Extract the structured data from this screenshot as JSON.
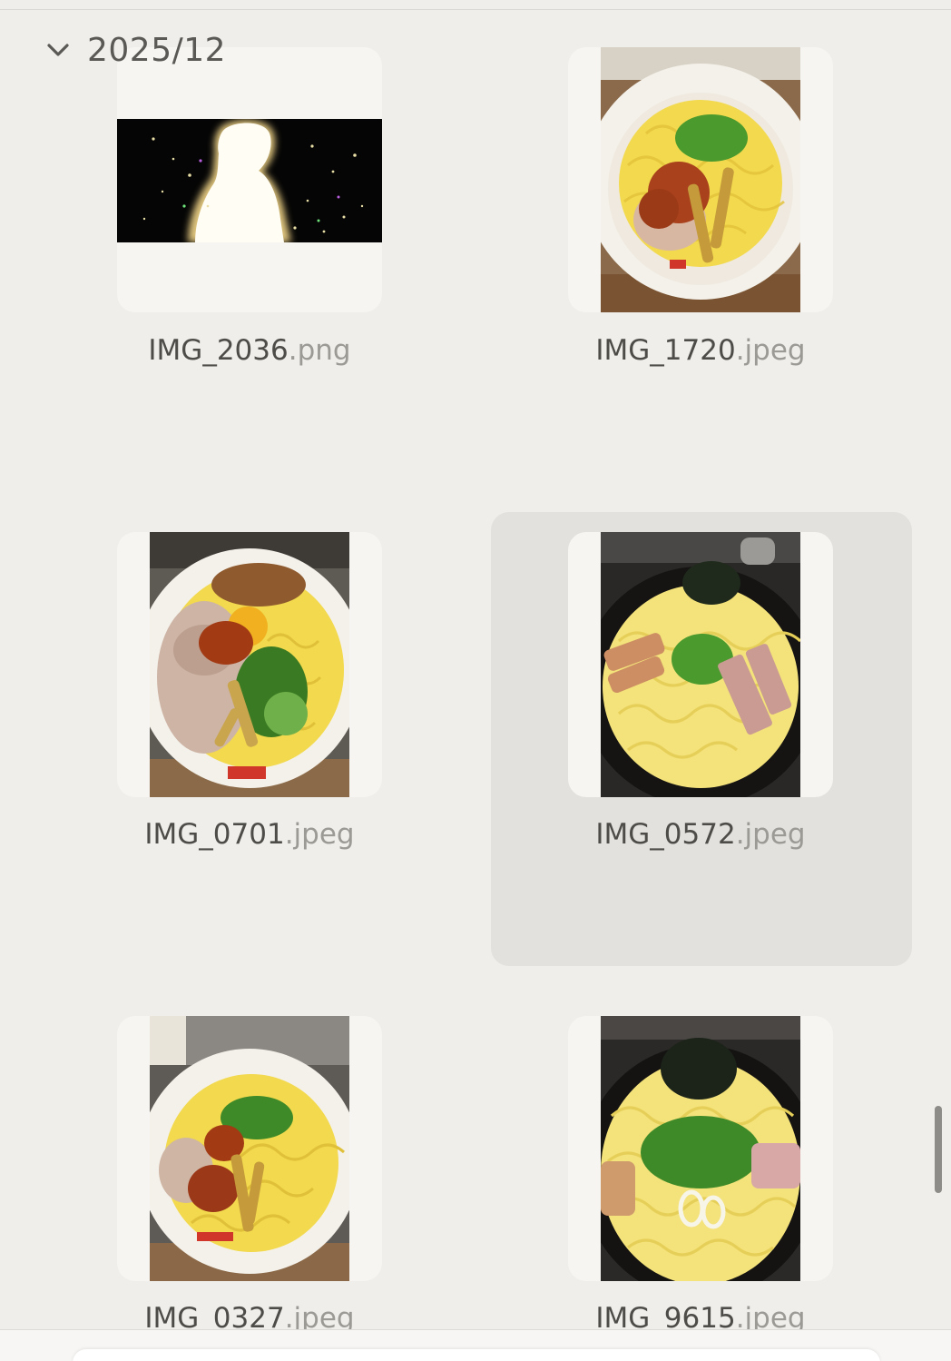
{
  "section": {
    "title": "2025/12",
    "collapse_icon": "chevron-down-icon"
  },
  "files": [
    {
      "name": "IMG_2036",
      "ext": ".png",
      "kind": "silhouette-image"
    },
    {
      "name": "IMG_1720",
      "ext": ".jpeg",
      "kind": "ramen-photo"
    },
    {
      "name": "IMG_0701",
      "ext": ".jpeg",
      "kind": "ramen-photo"
    },
    {
      "name": "IMG_0572",
      "ext": ".jpeg",
      "kind": "ramen-photo",
      "selected": true
    },
    {
      "name": "IMG_0327",
      "ext": ".jpeg",
      "kind": "ramen-photo"
    },
    {
      "name": "IMG_9615",
      "ext": ".jpeg",
      "kind": "ramen-photo"
    }
  ],
  "colors": {
    "background": "#efeeeb",
    "tile": "#f6f5f2",
    "selected_bg": "#e2e1de",
    "filename_text": "#4d4c48",
    "extension_text": "#9b9a95"
  }
}
